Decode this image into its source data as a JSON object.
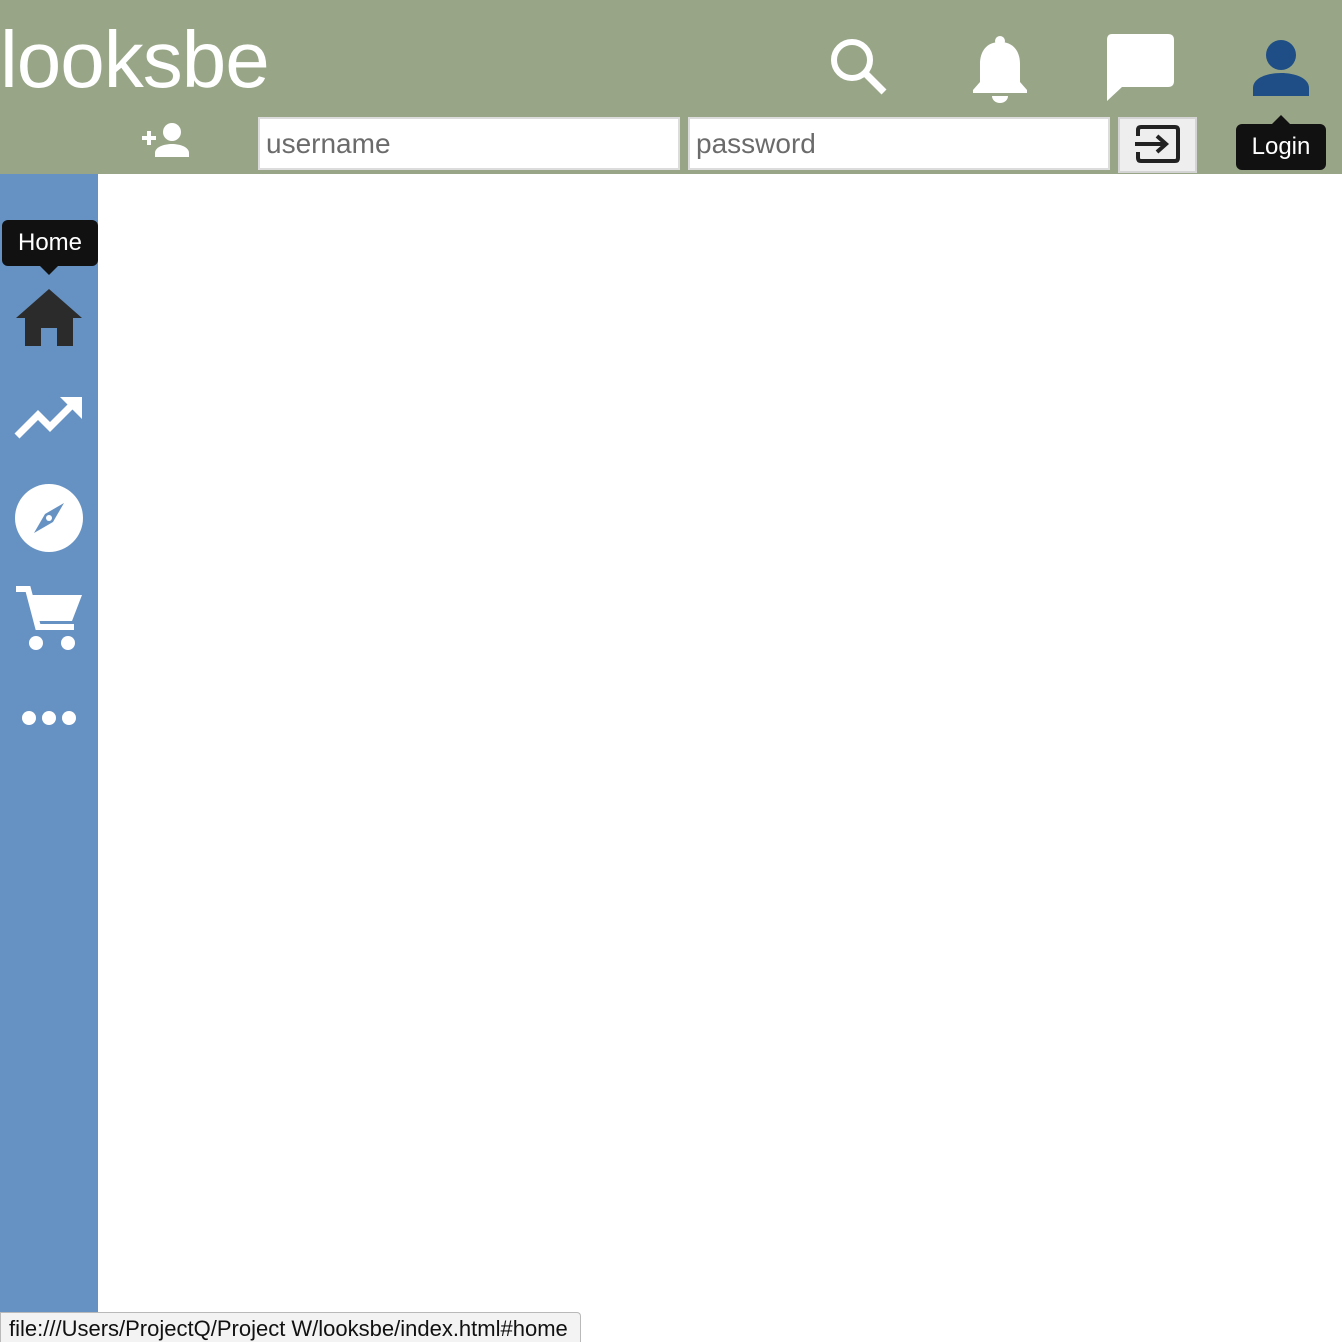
{
  "header": {
    "logo": "looksbe",
    "icons": [
      "search-icon",
      "bell-icon",
      "chat-icon",
      "account-icon",
      "add-user-icon"
    ],
    "login_form": {
      "username_placeholder": "username",
      "password_placeholder": "password",
      "submit_icon": "login-arrow-icon"
    },
    "login_tooltip": "Login"
  },
  "sidebar": {
    "tooltip": "Home",
    "items": [
      {
        "name": "home",
        "icon": "home-icon"
      },
      {
        "name": "trending",
        "icon": "trending-up-icon"
      },
      {
        "name": "explore",
        "icon": "compass-icon"
      },
      {
        "name": "shop",
        "icon": "cart-icon"
      },
      {
        "name": "more",
        "icon": "more-dots-icon"
      }
    ]
  },
  "status_bar": {
    "url": "file:///Users/ProjectQ/Project W/looksbe/index.html#home"
  },
  "colors": {
    "header_bg": "#98a687",
    "sidebar_bg": "#6692c3",
    "account_icon": "#1f4e86",
    "home_icon": "#2b2b2b",
    "tooltip_bg": "#111111"
  }
}
